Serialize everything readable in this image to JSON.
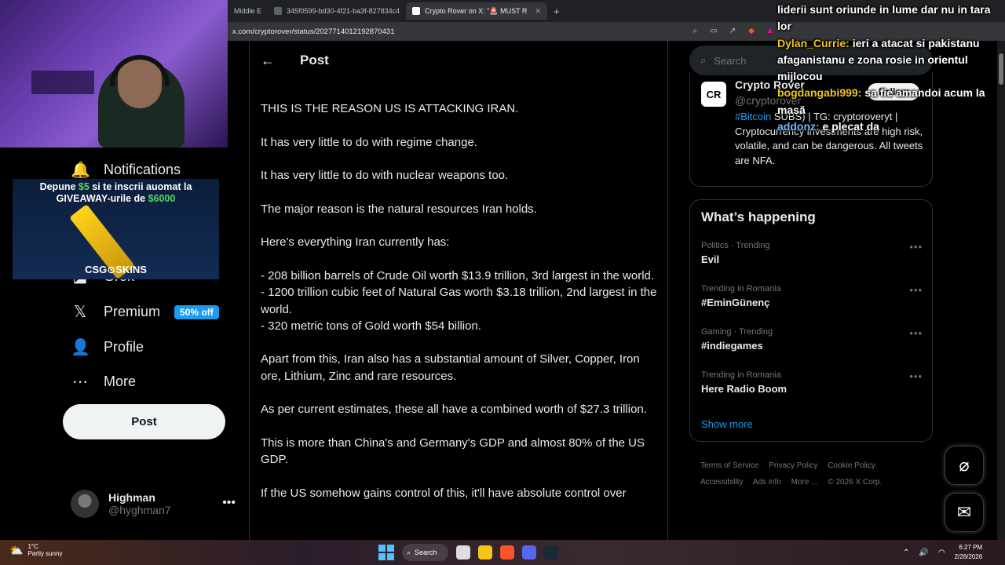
{
  "browser": {
    "tabs": [
      {
        "label": "Middle E"
      },
      {
        "label": "345f0599-bd30-4f21-ba3f-827834c4"
      },
      {
        "label": "Crypto Rover on X: \"🚨 MUST R"
      }
    ],
    "url": "x.com/cryptorover/status/2027714012192870431",
    "new_tab": "+"
  },
  "nav": {
    "items": [
      {
        "label": "Notifications",
        "icon": "bell-icon"
      },
      {
        "label": "Grok",
        "icon": "grok-icon"
      },
      {
        "label": "Premium",
        "icon": "x-logo-icon",
        "badge": "50% off"
      },
      {
        "label": "Profile",
        "icon": "person-icon"
      },
      {
        "label": "More",
        "icon": "more-circle-icon"
      }
    ],
    "post_button": "Post",
    "account": {
      "name": "Highman",
      "handle": "@hyghman7"
    }
  },
  "main": {
    "header_title": "Post",
    "paragraphs": [
      "THIS IS THE REASON US IS ATTACKING IRAN.",
      "It has very little to do with regime change.",
      "It has very little to do with nuclear weapons too.",
      "The major reason is the natural resources Iran holds.",
      "Here's everything Iran currently has:",
      "- 208 billion barrels of Crude Oil worth $13.9 trillion, 3rd largest in the world.\n- 1200 trillion cubic feet of Natural Gas worth $3.18 trillion, 2nd largest in the world.\n- 320 metric tons of Gold worth $54 billion.",
      "Apart from this, Iran also has a substantial amount of Silver, Copper, Iron ore, Lithium, Zinc and rare resources.",
      "As per current estimates, these all have a combined worth of $27.3 trillion.",
      "This is more than China's and Germany's GDP and almost 80% of the US GDP.",
      "If the US somehow gains control of this, it'll have absolute control over"
    ]
  },
  "sidebar": {
    "search_placeholder": "Search",
    "profile": {
      "logo": "CR",
      "name": "Crypto Rover",
      "handle": "@cryptorover",
      "follow": "Follow",
      "bio_tag": "#Bitcoin",
      "bio_rest": "SUBS) | TG: cryptoroveryt | Cryptocurrency investments are high risk, volatile, and can be dangerous. All tweets are NFA."
    },
    "whats_happening": {
      "title": "What’s happening",
      "trends": [
        {
          "meta": "Politics · Trending",
          "name": "Evil"
        },
        {
          "meta": "Trending in Romania",
          "name": "#EminGünenç"
        },
        {
          "meta": "Gaming · Trending",
          "name": "#indiegames"
        },
        {
          "meta": "Trending in Romania",
          "name": "Here Radio Boom"
        }
      ],
      "show_more": "Show more"
    },
    "footer": [
      "Terms of Service",
      "Privacy Policy",
      "Cookie Policy",
      "Accessibility",
      "Ads info",
      "More ...",
      "© 2026 X Corp."
    ]
  },
  "overlay": {
    "chat": [
      {
        "user": "",
        "text": "liderii sunt oriunde in lume dar nu in tara lor"
      },
      {
        "user": "Dylan_Currie:",
        "text": "ieri a atacat si pakistanu afaganistanu e zona rosie in orientul mijlocou"
      },
      {
        "user": "bogdangabi999:",
        "text": "sa fie amandoi acum la masă"
      },
      {
        "user": "addonz:",
        "text": "e plecat da"
      }
    ],
    "giveaway": {
      "line1_pre": "Depune ",
      "amount1": "$5",
      "line1_post": " si te inscrii auomat la",
      "line2_pre": "GIVEAWAY-urile de ",
      "amount2": "$6000",
      "brand": "CSG⊙SKINS"
    }
  },
  "taskbar": {
    "weather_temp": "1°C",
    "weather_desc": "Partly sunny",
    "search": "Search",
    "time": "6:27 PM",
    "date": "2/28/2026"
  },
  "colors": {
    "accent": "#1d9bf0",
    "background": "#000000",
    "muted": "#71767b"
  }
}
